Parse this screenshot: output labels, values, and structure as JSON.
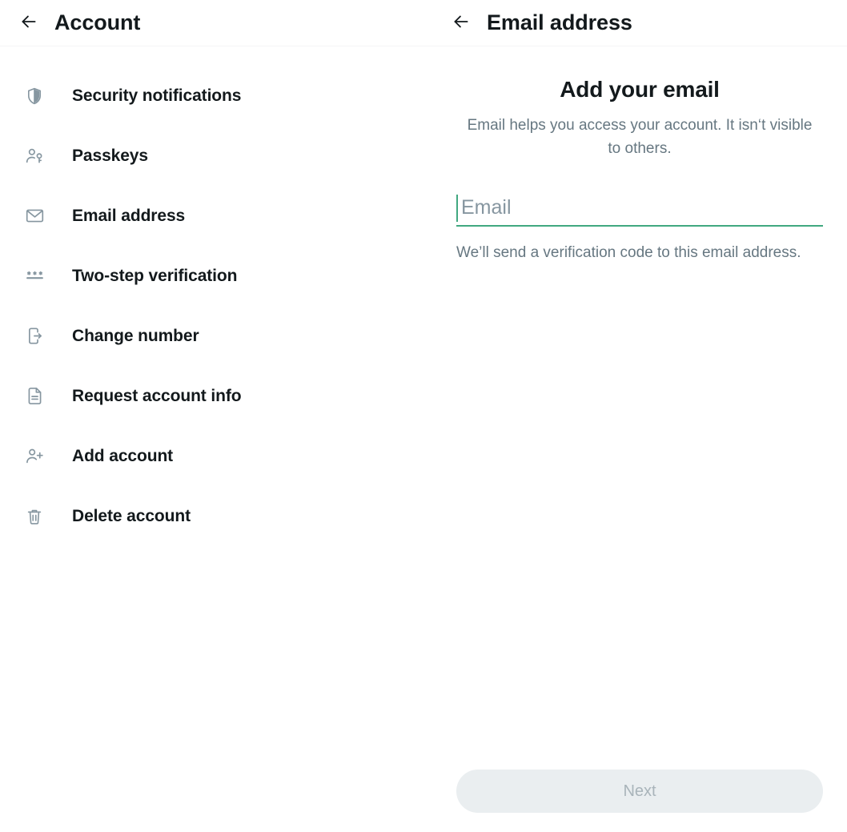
{
  "left": {
    "back_icon": "arrow-left-icon",
    "title": "Account",
    "items": [
      {
        "icon": "shield-icon",
        "label": "Security notifications"
      },
      {
        "icon": "passkey-icon",
        "label": "Passkeys"
      },
      {
        "icon": "envelope-icon",
        "label": "Email address"
      },
      {
        "icon": "asterisks-icon",
        "label": "Two-step verification"
      },
      {
        "icon": "phone-arrow-icon",
        "label": "Change number"
      },
      {
        "icon": "document-icon",
        "label": "Request account info"
      },
      {
        "icon": "person-plus-icon",
        "label": "Add account"
      },
      {
        "icon": "trash-icon",
        "label": "Delete account"
      }
    ]
  },
  "right": {
    "back_icon": "arrow-left-icon",
    "title": "Email address",
    "heading": "Add your email",
    "subtitle": "Email helps you access your account. It isn‘t visible to others.",
    "email_field": {
      "value": "",
      "placeholder": "Email",
      "help": "We’ll send a verification code to this email address."
    },
    "next_label": "Next"
  },
  "colors": {
    "accent_green": "#41a880",
    "text_primary": "#13191c",
    "text_secondary": "#667781",
    "icon_gray": "#8696a0",
    "button_disabled_bg": "#eaeef0",
    "button_disabled_text": "#a9b4ba"
  }
}
